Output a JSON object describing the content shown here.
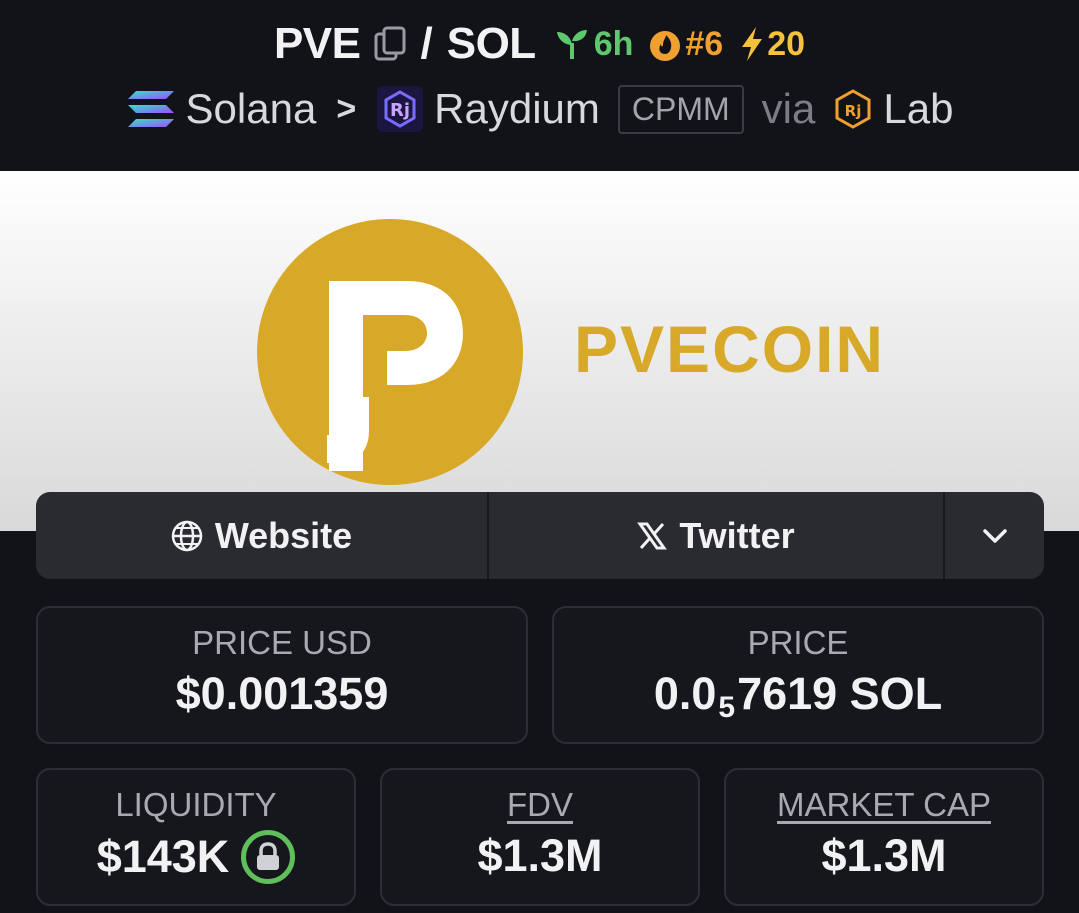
{
  "header": {
    "base_symbol": "PVE",
    "separator": "/",
    "quote_symbol": "SOL",
    "age": "6h",
    "rank": "#6",
    "boosts": "20",
    "chain": "Solana",
    "dex": "Raydium",
    "dex_badge": "CPMM",
    "via": "via",
    "launchpad": "Lab"
  },
  "banner": {
    "wordmark": "PVECOIN"
  },
  "links": {
    "website": "Website",
    "twitter": "Twitter"
  },
  "stats": {
    "price_usd_label": "PRICE USD",
    "price_usd_value": "$0.001359",
    "price_label": "PRICE",
    "price_prefix": "0.0",
    "price_zeros": "5",
    "price_suffix": "7619 SOL",
    "liquidity_label": "LIQUIDITY",
    "liquidity_value": "$143K",
    "fdv_label": "FDV",
    "fdv_value": "$1.3M",
    "mcap_label": "MARKET CAP",
    "mcap_value": "$1.3M"
  },
  "colors": {
    "background": "#121318",
    "age_green": "#5fc86e",
    "rank_orange": "#f0a030",
    "boost_yellow": "#f5c33b",
    "brand_gold": "#d8a928",
    "lock_green": "#5fbf5a"
  },
  "icons": [
    "copy-icon",
    "seedling-icon",
    "flame-icon",
    "lightning-icon",
    "solana-icon",
    "raydium-icon",
    "launchlab-icon",
    "globe-icon",
    "x-icon",
    "chevron-down-icon",
    "lock-icon"
  ]
}
